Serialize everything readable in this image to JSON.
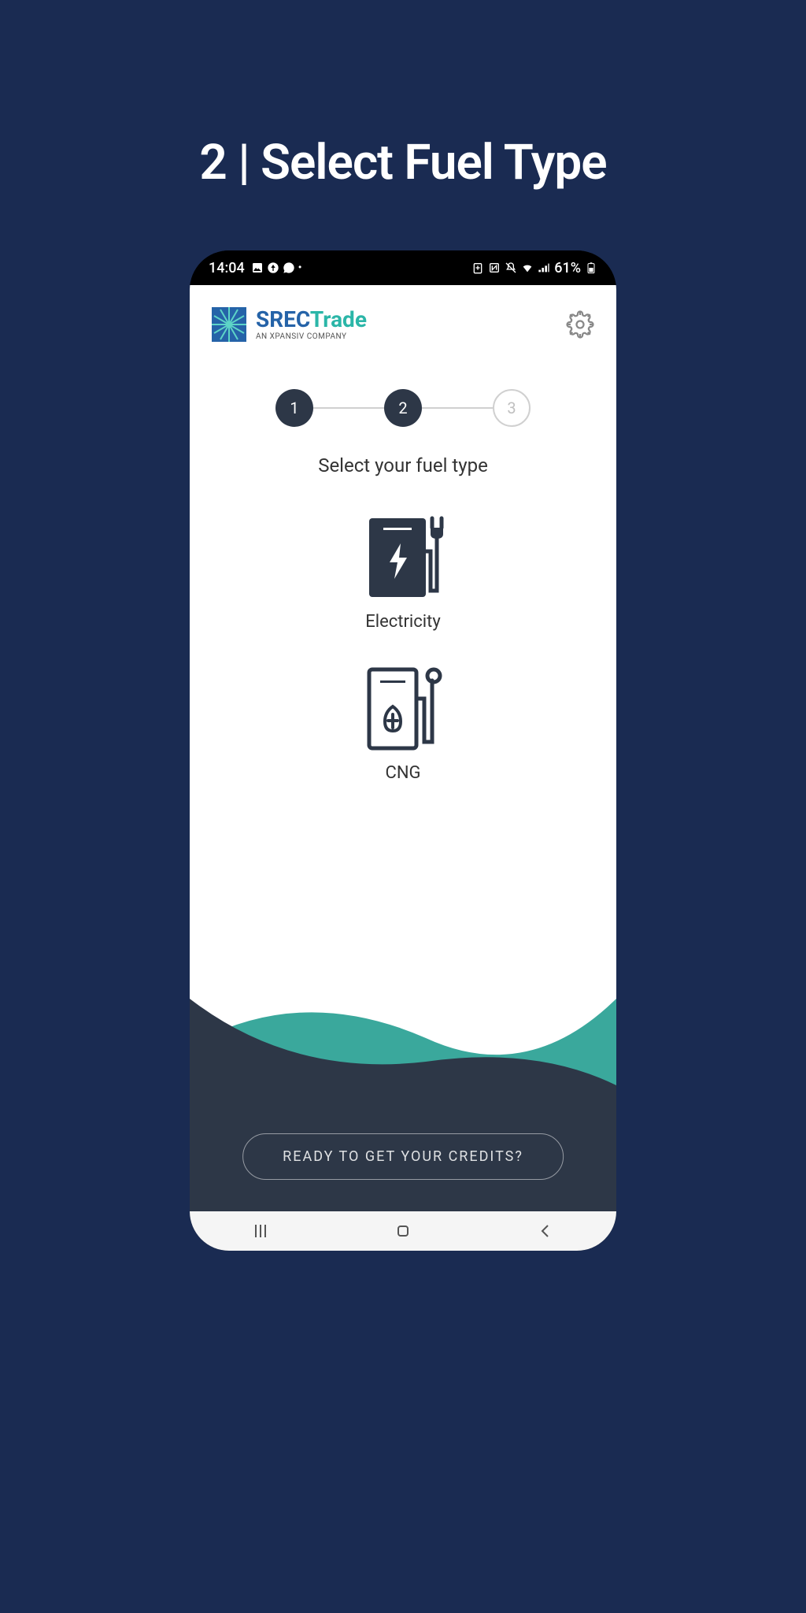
{
  "page": {
    "title": "2 | Select Fuel Type"
  },
  "statusBar": {
    "time": "14:04",
    "battery": "61%"
  },
  "app": {
    "brand": {
      "srec": "SREC",
      "trade": "Trade",
      "tagline": "AN XPANSIV COMPANY"
    },
    "stepper": {
      "steps": [
        "1",
        "2",
        "3"
      ]
    },
    "sectionTitle": "Select your fuel type",
    "fuelOptions": [
      {
        "label": "Electricity"
      },
      {
        "label": "CNG"
      }
    ],
    "cta": "READY TO GET YOUR CREDITS?"
  }
}
